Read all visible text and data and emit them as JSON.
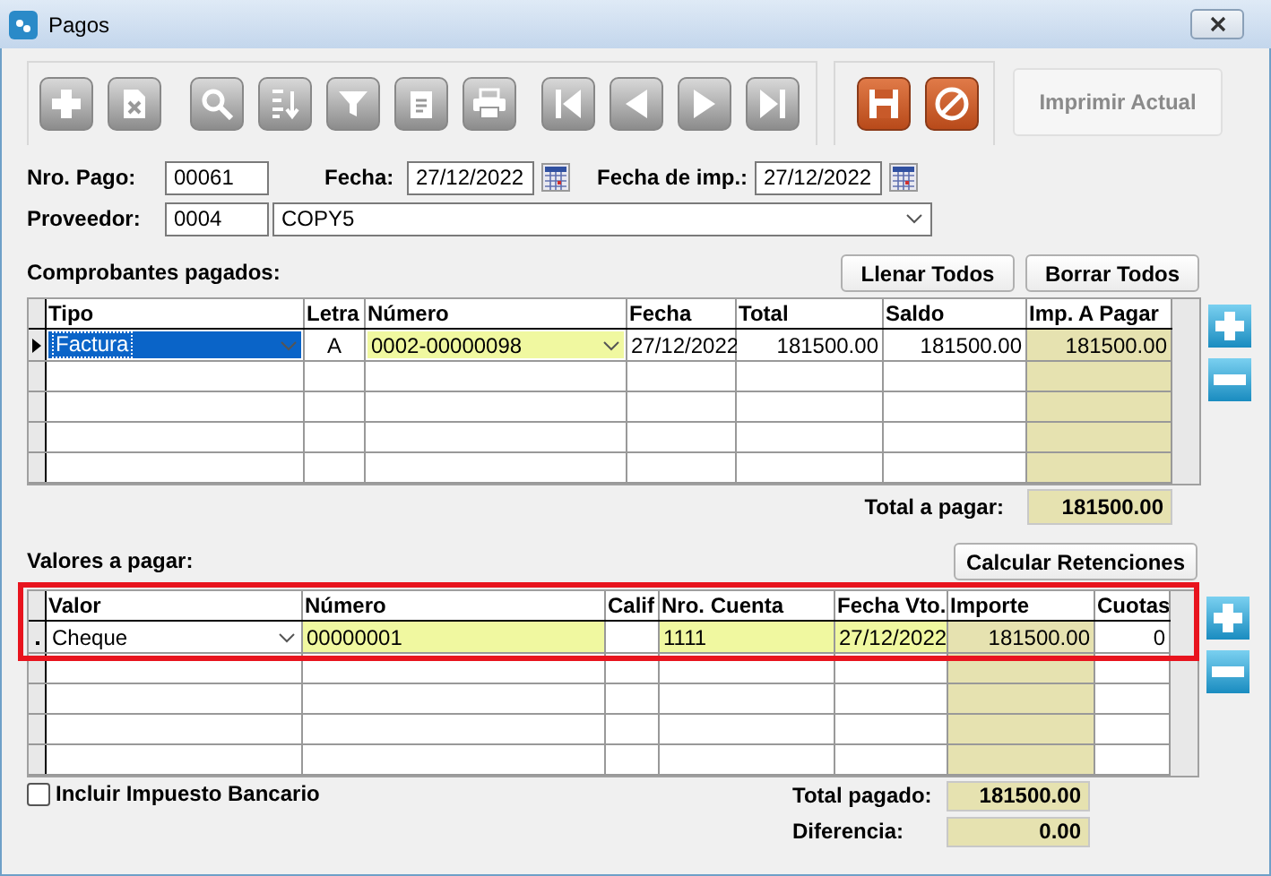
{
  "window": {
    "title": "Pagos"
  },
  "print_button": "Imprimir Actual",
  "header": {
    "nro_pago": {
      "label": "Nro. Pago:",
      "value": "00061"
    },
    "fecha": {
      "label": "Fecha:",
      "value": "27/12/2022"
    },
    "fecha_imp": {
      "label": "Fecha de imp.:",
      "value": "27/12/2022"
    },
    "proveedor": {
      "label": "Proveedor:",
      "code": "0004",
      "name": "COPY5"
    }
  },
  "comprobantes": {
    "title": "Comprobantes pagados:",
    "buttons": [
      "Llenar Todos",
      "Borrar Todos"
    ],
    "columns": [
      {
        "label": "Tipo",
        "kind": "combo"
      },
      {
        "label": "Letra",
        "kind": "letter"
      },
      {
        "label": "Número",
        "kind": "combo",
        "highlight": true
      },
      {
        "label": "Fecha",
        "kind": "text"
      },
      {
        "label": "Total",
        "kind": "number"
      },
      {
        "label": "Saldo",
        "kind": "number"
      },
      {
        "label": "Imp. A Pagar",
        "kind": "amount"
      }
    ],
    "rows": [
      {
        "selected": true,
        "cells": [
          "Factura",
          "A",
          "0002-00000098",
          "27/12/2022",
          "181500.00",
          "181500.00",
          "181500.00"
        ]
      }
    ],
    "total": {
      "label": "Total a pagar:",
      "value": "181500.00"
    }
  },
  "valores": {
    "title": "Valores a pagar:",
    "button": "Calcular Retenciones",
    "highlighted": true,
    "columns": [
      {
        "label": "Valor",
        "kind": "combo"
      },
      {
        "label": "Número",
        "kind": "text",
        "highlight": true
      },
      {
        "label": "Calif",
        "kind": "text"
      },
      {
        "label": "Nro. Cuenta",
        "kind": "text",
        "highlight": true
      },
      {
        "label": "Fecha Vto.",
        "kind": "text",
        "highlight": true
      },
      {
        "label": "Importe",
        "kind": "amount"
      },
      {
        "label": "Cuotas",
        "kind": "number"
      }
    ],
    "rows": [
      {
        "selected": false,
        "cells": [
          "Cheque",
          "00000001",
          "",
          "1111",
          "27/12/2022",
          "181500.00",
          "0"
        ]
      }
    ]
  },
  "impuesto_checkbox": {
    "label": "Incluir Impuesto Bancario",
    "checked": false
  },
  "totals": [
    {
      "label": "Total pagado:",
      "value": "181500.00"
    },
    {
      "label": "Diferencia:",
      "value": "0.00"
    }
  ]
}
